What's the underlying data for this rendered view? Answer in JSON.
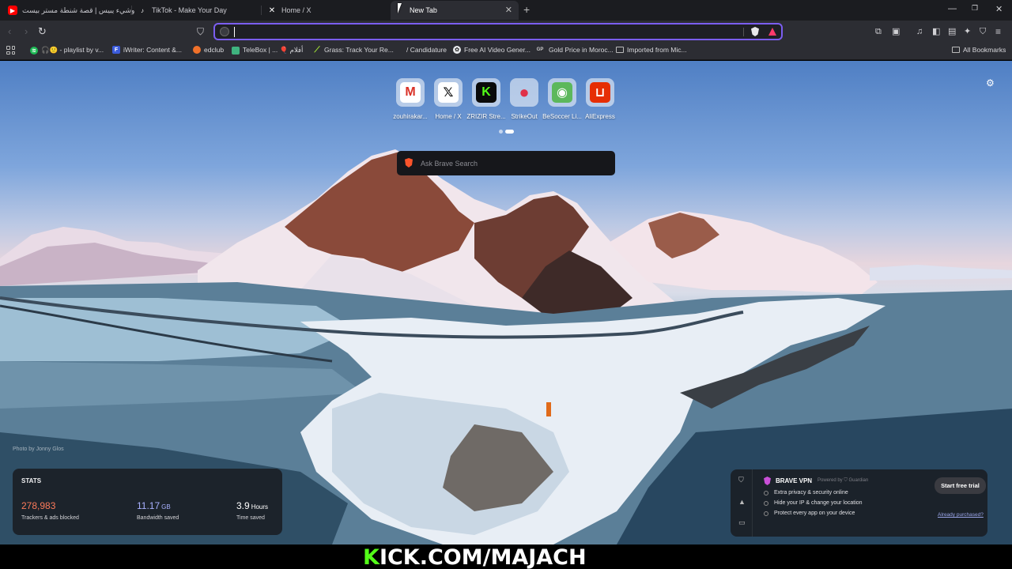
{
  "tabs": [
    {
      "title": "وشيء يبيس | قصة شنطة مستر بيست 😉",
      "favicon": "youtube-icon",
      "active": false
    },
    {
      "title": "TikTok - Make Your Day",
      "favicon": "tiktok-icon",
      "active": false
    },
    {
      "title": "Home / X",
      "favicon": "x-icon",
      "active": false
    },
    {
      "title": "New Tab",
      "favicon": "",
      "active": true
    }
  ],
  "window_controls": {
    "minimize": "—",
    "restore": "❐",
    "close": "✕"
  },
  "toolbar": {
    "address_value": "",
    "address_placeholder": ""
  },
  "bookmarks": [
    {
      "label": "🎧🙂 - playlist by v...",
      "icon": "spotify-icon",
      "color": "#1db954"
    },
    {
      "label": "iWriter: Content &...",
      "icon": "iwriter-icon",
      "color": "#3b5bdb"
    },
    {
      "label": "edclub",
      "icon": "edclub-icon",
      "color": "#f0712a"
    },
    {
      "label": "TeleBox | ... 🎈 أفلام",
      "icon": "telebox-icon",
      "color": "#3fb37f"
    },
    {
      "label": "Grass: Track Your Re...",
      "icon": "grass-icon",
      "color": "#a3e635"
    },
    {
      "label": "/ Candidature",
      "icon": "page-icon",
      "color": "#555"
    },
    {
      "label": "Free AI Video Gener...",
      "icon": "ai-video-icon",
      "color": "#e5e7eb"
    },
    {
      "label": "Gold Price in Moroc...",
      "icon": "gp-icon",
      "color": "#444"
    },
    {
      "label": "Imported from Mic...",
      "icon": "folder-icon",
      "color": "transparent"
    }
  ],
  "all_bookmarks": "All Bookmarks",
  "top_sites": [
    {
      "label": "zouhirakar...",
      "icon": "gmail-icon",
      "glyph": "M",
      "bg": "#ffffff",
      "fg": "#d93025"
    },
    {
      "label": "Home / X",
      "icon": "x-icon",
      "glyph": "𝕏",
      "bg": "#ffffff",
      "fg": "#000000"
    },
    {
      "label": "ZRIZIR Stre...",
      "icon": "kick-icon",
      "glyph": "K",
      "bg": "#0a0a0a",
      "fg": "#53fc18"
    },
    {
      "label": "StrikeOut",
      "icon": "strikeout-icon",
      "glyph": "●",
      "bg": "transparent",
      "fg": "#e03048"
    },
    {
      "label": "BeSoccer Li...",
      "icon": "besoccer-icon",
      "glyph": "◉",
      "bg": "#5cb85c",
      "fg": "#ffffff"
    },
    {
      "label": "AliExpress",
      "icon": "aliexpress-icon",
      "glyph": "⊔",
      "bg": "#e62e04",
      "fg": "#ffffff"
    }
  ],
  "search": {
    "placeholder": "Ask Brave Search"
  },
  "photo_credit": "Photo by Jonny Glos",
  "stats": {
    "title": "STATS",
    "items": [
      {
        "value": "278,983",
        "unit": "",
        "label": "Trackers & ads blocked",
        "color": "#fb7a5a"
      },
      {
        "value": "11.17",
        "unit": "GB",
        "label": "Bandwidth saved",
        "color": "#a8b1ff"
      },
      {
        "value": "3.9",
        "unit": "Hours",
        "label": "Time saved",
        "color": "#ffffff"
      }
    ]
  },
  "vpn": {
    "title": "BRAVE VPN",
    "powered_by": "Powered by ⛉ Guardian",
    "features": [
      "Extra privacy & security online",
      "Hide your IP & change your location",
      "Protect every app on your device"
    ],
    "cta": "Start free trial",
    "already_purchased": "Already purchased?"
  },
  "banner": {
    "brand_k": "K",
    "brand_rest": "ICK.COM/MAJACH"
  },
  "colors": {
    "accent": "#7b5ef0",
    "kick_green": "#53fc18",
    "brave_orange": "#fb542b"
  }
}
